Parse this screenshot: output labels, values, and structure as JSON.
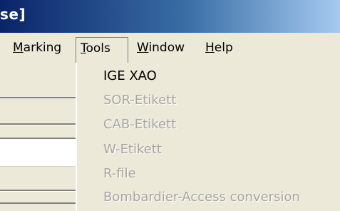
{
  "window": {
    "title_fragment": "se]"
  },
  "menubar": {
    "items": [
      {
        "label": "Marking",
        "mnemonic": "M"
      },
      {
        "label": "Tools",
        "mnemonic": "T",
        "open": true
      },
      {
        "label": "Window",
        "mnemonic": "W"
      },
      {
        "label": "Help",
        "mnemonic": "H"
      }
    ]
  },
  "tools_menu": {
    "items": [
      {
        "label": "IGE XAO",
        "enabled": true
      },
      {
        "label": "SOR-Etikett",
        "enabled": false
      },
      {
        "label": "CAB-Etikett",
        "enabled": false
      },
      {
        "label": "W-Etikett",
        "enabled": false
      },
      {
        "label": "R-file",
        "enabled": false
      },
      {
        "label": "Bombardier-Access conversion",
        "enabled": false
      }
    ]
  },
  "colors": {
    "title_gradient_start": "#0a246a",
    "title_gradient_end": "#a6caf0",
    "menu_background": "#ece9d8",
    "disabled_text": "#a7a6a0"
  }
}
